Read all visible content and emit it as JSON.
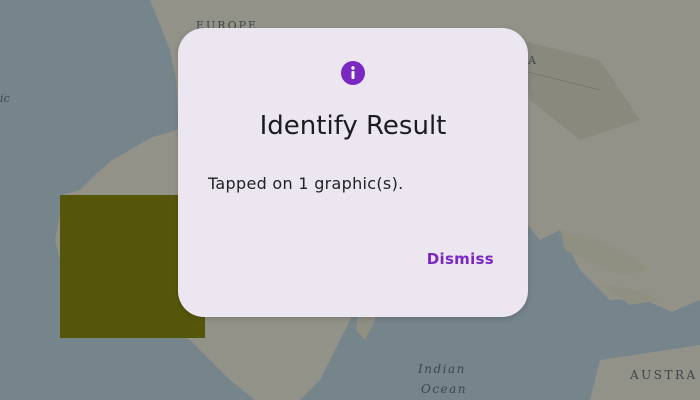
{
  "map": {
    "labels": {
      "europe": "EUROPE",
      "asia": "A",
      "indian": "Indian",
      "ocean": "Ocean",
      "australia": "AUSTRA",
      "left_edge": "ic"
    },
    "graphic_color": "#707000"
  },
  "dialog": {
    "icon": "info-icon",
    "title": "Identify Result",
    "message": "Tapped on 1 graphic(s).",
    "dismiss_label": "Dismiss",
    "accent_color": "#7b27c2",
    "background_color": "#ece6f0"
  }
}
